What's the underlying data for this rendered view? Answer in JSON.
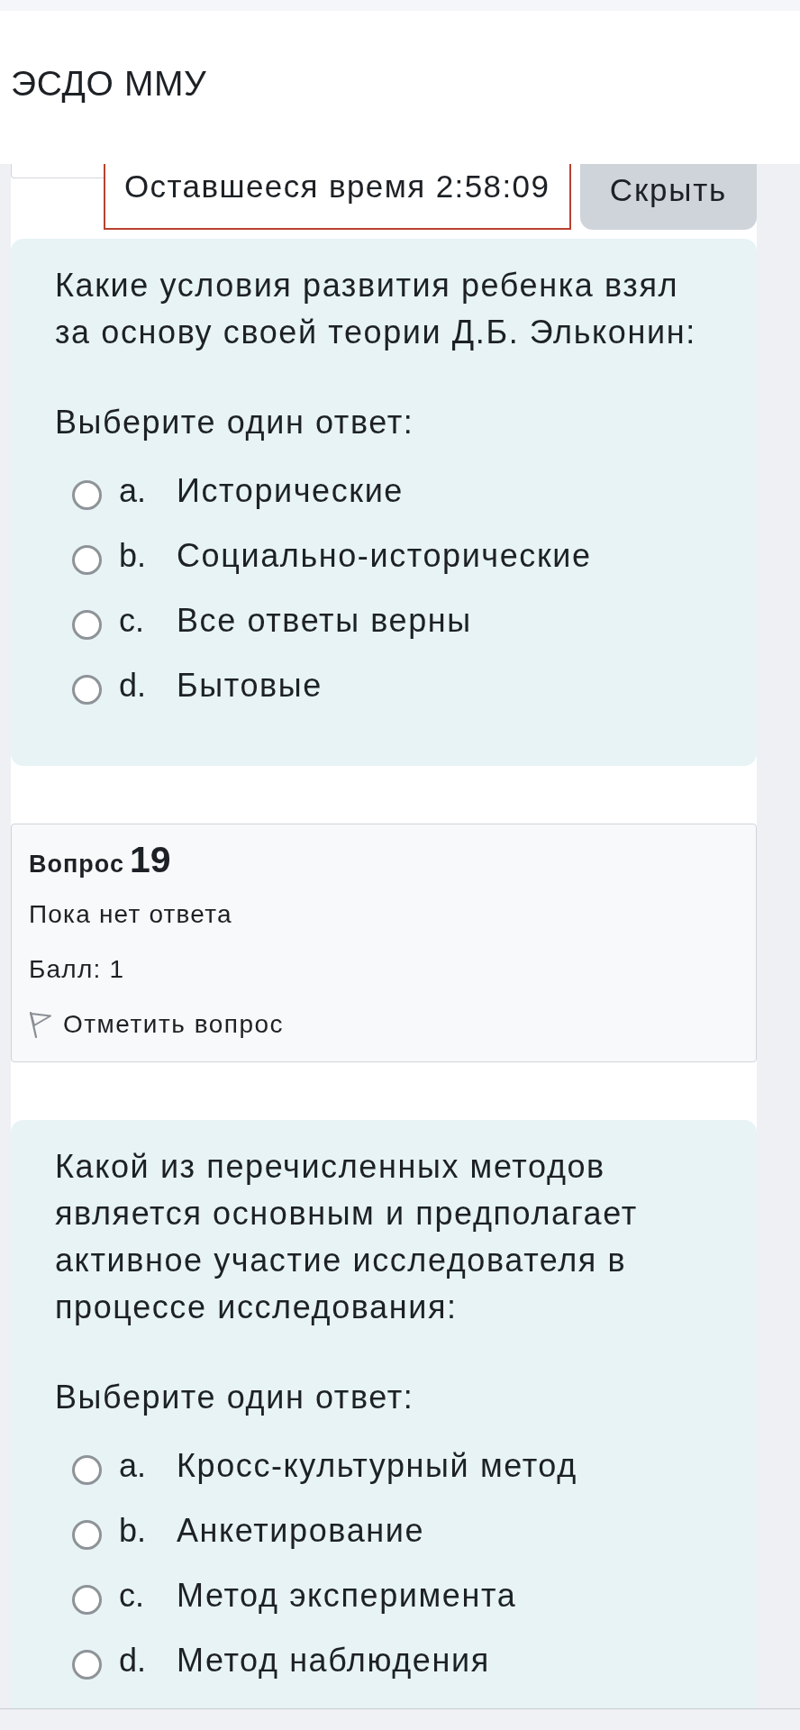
{
  "header": {
    "title": "ЭСДО ММУ"
  },
  "timer": {
    "text": "Оставшееся время 2:58:09"
  },
  "hide_button": {
    "label": "Скрыть"
  },
  "blocks": [
    {
      "kind": "question",
      "text": "Какие условия развития ребенка взял за основу своей теории Д.Б. Эльконин:",
      "prompt": "Выберите один ответ:",
      "options": [
        {
          "letter": "a.",
          "text": "Исторические",
          "selected": false
        },
        {
          "letter": "b.",
          "text": "Социально-исторические",
          "selected": false
        },
        {
          "letter": "c.",
          "text": "Все ответы верны",
          "selected": false
        },
        {
          "letter": "d.",
          "text": "Бытовые",
          "selected": false
        }
      ]
    },
    {
      "kind": "info",
      "label": "Вопрос",
      "number": "19",
      "status": "Пока нет ответа",
      "grade": "Балл: 1",
      "flag": {
        "label": "Отметить вопрос",
        "flagged": false
      }
    },
    {
      "kind": "question",
      "text": "Какой из перечисленных методов является основным и предполагает активное участие исследователя в процессе исследования:",
      "prompt": "Выберите один ответ:",
      "options": [
        {
          "letter": "a.",
          "text": "Кросс-культурный метод",
          "selected": false
        },
        {
          "letter": "b.",
          "text": "Анкетирование",
          "selected": false
        },
        {
          "letter": "c.",
          "text": "Метод эксперимента",
          "selected": false
        },
        {
          "letter": "d.",
          "text": "Метод наблюдения",
          "selected": false
        }
      ]
    }
  ]
}
